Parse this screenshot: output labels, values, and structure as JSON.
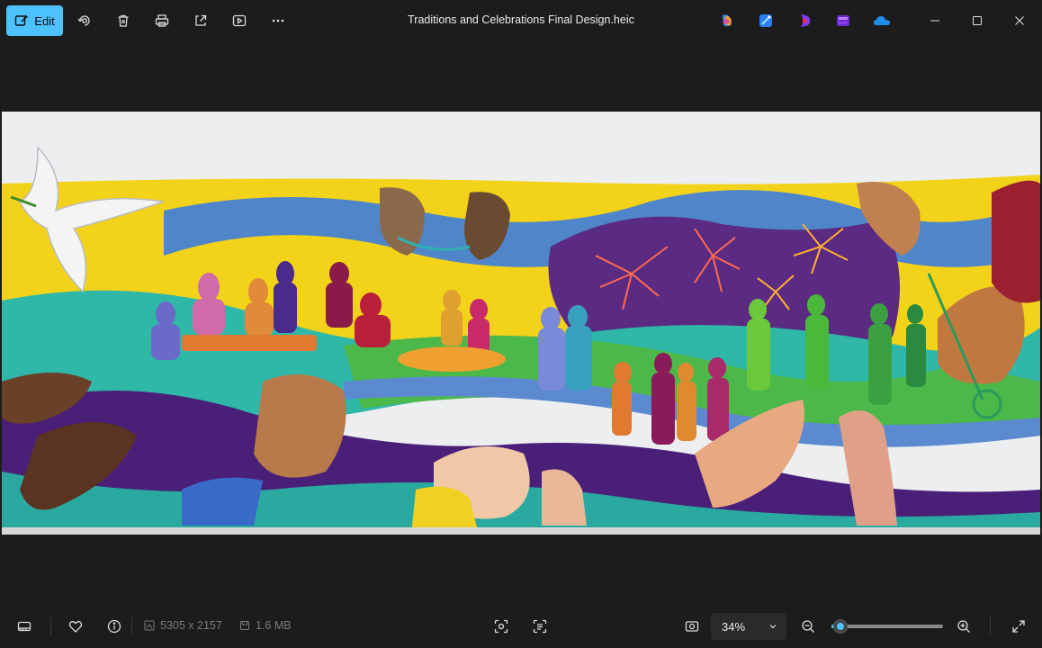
{
  "toolbar": {
    "edit_label": "Edit",
    "file_title": "Traditions and Celebrations Final Design.heic",
    "icons": [
      "edit-icon",
      "rotate-icon",
      "delete-icon",
      "print-icon",
      "share-icon",
      "slideshow-icon",
      "more-icon"
    ],
    "apps": [
      "copilot-icon",
      "designer-icon",
      "clipchamp-icon",
      "editor-app-icon",
      "onedrive-icon"
    ],
    "window_controls": [
      "minimize-icon",
      "maximize-icon",
      "close-icon"
    ]
  },
  "image": {
    "alt": "Traditions and Celebrations mural design"
  },
  "bottombar": {
    "dimensions": "5305 x 2157",
    "file_size": "1.6 MB",
    "zoom": "34%",
    "zoom_level": 0.08,
    "colors": {
      "accent": "#4cc2ff",
      "background": "#1c1c1c"
    }
  }
}
